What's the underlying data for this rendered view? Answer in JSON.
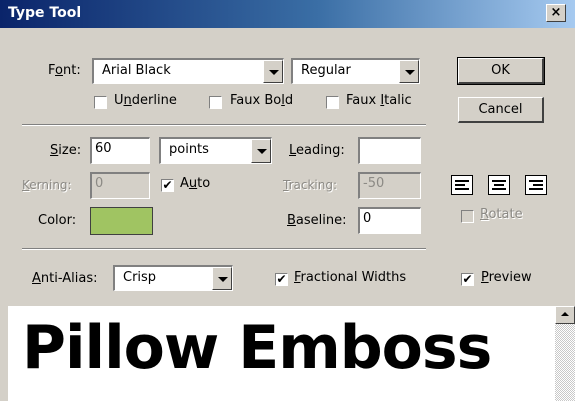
{
  "window": {
    "title": "Type Tool",
    "close_label": "×"
  },
  "font": {
    "label": "Font:",
    "family": "Arial Black",
    "style": "Regular",
    "underline_label": "Underline",
    "underline_checked": false,
    "faux_bold_label": "Faux Bold",
    "faux_bold_checked": false,
    "faux_italic_label": "Faux Italic",
    "faux_italic_checked": false
  },
  "buttons": {
    "ok": "OK",
    "cancel": "Cancel"
  },
  "size": {
    "label": "Size:",
    "value": "60",
    "unit": "points"
  },
  "leading": {
    "label": "Leading:",
    "value": ""
  },
  "kerning": {
    "label": "Kerning:",
    "value": "0",
    "auto_label": "Auto",
    "auto_checked": true
  },
  "tracking": {
    "label": "Tracking:",
    "value": "-50"
  },
  "color": {
    "label": "Color:",
    "swatch": "#a0c462"
  },
  "baseline": {
    "label": "Baseline:",
    "value": "0"
  },
  "alignment": {
    "options": [
      "align-left",
      "align-center",
      "align-right"
    ],
    "selected": "align-left"
  },
  "rotate": {
    "label": "Rotate",
    "checked": false,
    "enabled": false
  },
  "anti_alias": {
    "label": "Anti-Alias:",
    "value": "Crisp"
  },
  "fractional_widths": {
    "label": "Fractional Widths",
    "checked": true
  },
  "preview": {
    "label": "Preview",
    "checked": true,
    "sample_text": "Pillow Emboss"
  }
}
